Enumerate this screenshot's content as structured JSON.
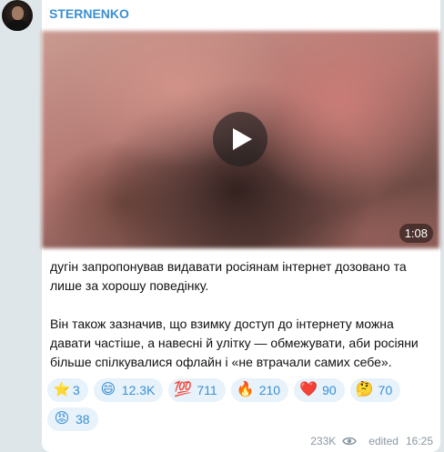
{
  "channel": {
    "name": "STERNENKO"
  },
  "video": {
    "duration": "1:08"
  },
  "message": {
    "paragraph1": "дугін запропонував видавати росіянам інтернет дозовано та лише за хорошу поведінку.",
    "paragraph2": "Він також зазначив, що взимку доступ до інтернету можна давати частіше, а навесні й улітку — обмежувати, аби росіяни більше спілкувалися офлайн і «не втрачали самих себе»."
  },
  "reactions": [
    {
      "emoji": "⭐",
      "icon": "star-icon",
      "count": "3"
    },
    {
      "emoji": "😄",
      "icon": "grinning-face-icon",
      "count": "12.3K"
    },
    {
      "emoji": "💯",
      "icon": "hundred-points-icon",
      "count": "711"
    },
    {
      "emoji": "🔥",
      "icon": "fire-icon",
      "count": "210"
    },
    {
      "emoji": "❤️",
      "icon": "red-heart-icon",
      "count": "90"
    },
    {
      "emoji": "🤔",
      "icon": "thinking-face-icon",
      "count": "70"
    },
    {
      "emoji": "😡",
      "icon": "angry-face-icon",
      "count": "38"
    }
  ],
  "footer": {
    "views": "233K",
    "edited_label": "edited",
    "time": "16:25"
  },
  "colors": {
    "accent": "#3a8fd1",
    "reaction_bg": "#e7f2fb",
    "meta": "#8a97a3",
    "background": "#dfe6ea"
  }
}
